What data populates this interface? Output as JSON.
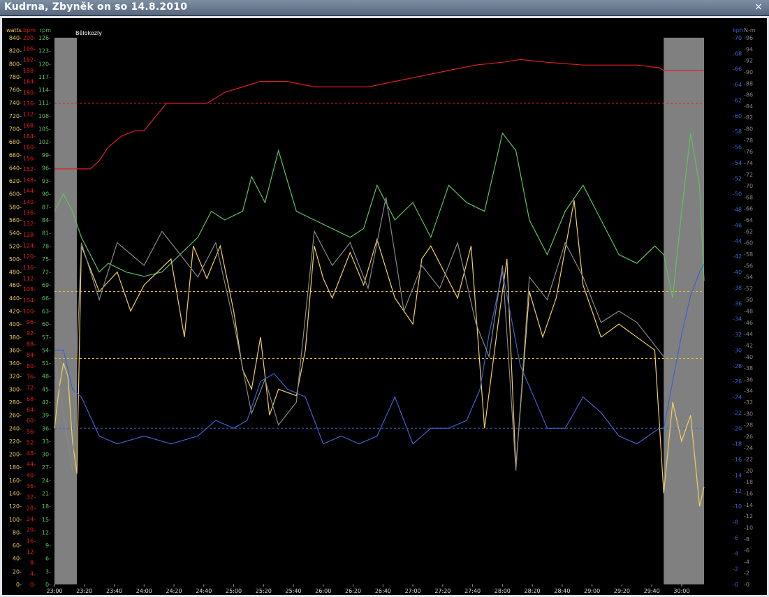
{
  "window": {
    "title": "Kudrna, Zbyněk on so 14.8.2010",
    "close_glyph": "×"
  },
  "chart_data": {
    "type": "line",
    "title": "",
    "annotation": "Bělokozly",
    "xlabel": "",
    "x_tick_labels": [
      "23:00",
      "23:20",
      "23:40",
      "24:00",
      "24:20",
      "24:40",
      "25:00",
      "25:20",
      "25:40",
      "26:00",
      "26:20",
      "26:40",
      "27:00",
      "27:20",
      "27:40",
      "28:00",
      "28:20",
      "28:40",
      "29:00",
      "29:20",
      "29:40",
      "30:00"
    ],
    "x_range_min": [
      23.0,
      30.25
    ],
    "grid": false,
    "shaded_regions_min": [
      [
        23.0,
        23.25
      ],
      [
        29.8,
        30.25
      ]
    ],
    "colors": {
      "watts": "#f0d060",
      "bpm": "#e02020",
      "rpm": "#60c060",
      "kph": "#4060d0",
      "nm": "#888888",
      "shade": "#808080"
    },
    "axes": {
      "watts": {
        "label": "watts",
        "side": "left",
        "range": [
          0,
          840
        ],
        "step": 20
      },
      "bpm": {
        "label": "bpm",
        "side": "left",
        "range": [
          0,
          200
        ],
        "step": 4
      },
      "rpm": {
        "label": "rpm",
        "side": "left",
        "range": [
          0,
          126
        ],
        "step": 3
      },
      "kph": {
        "label": "kph",
        "side": "right",
        "range": [
          0,
          70
        ],
        "step": 2
      },
      "nm": {
        "label": "N-m",
        "side": "right",
        "range": [
          0,
          96
        ],
        "step": 2
      }
    },
    "reference_lines": [
      {
        "series": "bpm",
        "value": 176,
        "color": "#e02020"
      },
      {
        "series": "watts",
        "value": 450,
        "color": "#e8c030"
      },
      {
        "series": "watts",
        "value": 347,
        "color": "#e8c030"
      },
      {
        "series": "kph",
        "value": 20,
        "color": "#4060d0"
      }
    ],
    "series": [
      {
        "name": "bpm",
        "unit_axis": "bpm",
        "x": [
          23.0,
          23.4,
          23.5,
          23.6,
          23.75,
          23.9,
          24.0,
          24.25,
          24.5,
          24.7,
          24.9,
          25.1,
          25.3,
          25.6,
          25.9,
          26.2,
          26.5,
          26.8,
          27.1,
          27.4,
          27.7,
          28.0,
          28.2,
          28.5,
          28.9,
          29.2,
          29.5,
          29.75,
          29.8,
          30.25
        ],
        "values": [
          152,
          152,
          155,
          160,
          164,
          166,
          166,
          176,
          176,
          176,
          180,
          182,
          184,
          184,
          182,
          182,
          182,
          184,
          186,
          188,
          190,
          191,
          192,
          191,
          190,
          190,
          190,
          189,
          188,
          188
        ]
      },
      {
        "name": "rpm",
        "unit_axis": "rpm",
        "x": [
          23.0,
          23.1,
          23.2,
          23.3,
          23.5,
          23.6,
          23.8,
          24.0,
          24.2,
          24.4,
          24.6,
          24.75,
          24.9,
          25.1,
          25.2,
          25.35,
          25.5,
          25.7,
          25.9,
          26.1,
          26.3,
          26.45,
          26.6,
          26.8,
          27.0,
          27.2,
          27.4,
          27.6,
          27.8,
          27.9,
          28.0,
          28.15,
          28.3,
          28.5,
          28.7,
          28.9,
          29.1,
          29.3,
          29.5,
          29.7,
          29.8,
          29.9,
          30.0,
          30.1,
          30.2,
          30.25
        ],
        "values": [
          86,
          90,
          86,
          80,
          72,
          74,
          72,
          71,
          72,
          76,
          80,
          86,
          84,
          86,
          94,
          88,
          100,
          86,
          84,
          82,
          80,
          82,
          92,
          84,
          88,
          80,
          92,
          88,
          86,
          95,
          104,
          100,
          84,
          76,
          86,
          92,
          84,
          76,
          74,
          78,
          76,
          66,
          86,
          104,
          92,
          70
        ]
      },
      {
        "name": "watts",
        "unit_axis": "watts",
        "x": [
          23.0,
          23.05,
          23.1,
          23.15,
          23.2,
          23.25,
          23.3,
          23.5,
          23.7,
          23.85,
          24.0,
          24.15,
          24.3,
          24.45,
          24.55,
          24.7,
          24.85,
          25.0,
          25.1,
          25.2,
          25.3,
          25.4,
          25.5,
          25.7,
          25.8,
          25.9,
          26.0,
          26.1,
          26.3,
          26.45,
          26.6,
          26.8,
          27.0,
          27.1,
          27.2,
          27.35,
          27.5,
          27.65,
          27.8,
          27.95,
          28.05,
          28.15,
          28.3,
          28.45,
          28.6,
          28.8,
          28.9,
          29.0,
          29.1,
          29.3,
          29.5,
          29.7,
          29.8,
          29.9,
          30.0,
          30.1,
          30.2,
          30.25
        ],
        "values": [
          240,
          300,
          340,
          320,
          220,
          170,
          520,
          450,
          480,
          420,
          460,
          480,
          500,
          380,
          520,
          470,
          520,
          420,
          330,
          300,
          380,
          260,
          300,
          290,
          360,
          520,
          470,
          440,
          510,
          460,
          530,
          440,
          400,
          500,
          520,
          480,
          440,
          520,
          240,
          400,
          500,
          180,
          450,
          380,
          440,
          590,
          460,
          420,
          380,
          400,
          380,
          360,
          140,
          280,
          220,
          260,
          120,
          150
        ]
      },
      {
        "name": "kph",
        "unit_axis": "kph",
        "x": [
          23.0,
          23.1,
          23.2,
          23.3,
          23.5,
          23.7,
          24.0,
          24.3,
          24.6,
          24.8,
          25.0,
          25.15,
          25.3,
          25.45,
          25.6,
          25.8,
          26.0,
          26.2,
          26.4,
          26.6,
          26.8,
          27.0,
          27.2,
          27.4,
          27.6,
          27.75,
          27.85,
          28.0,
          28.2,
          28.35,
          28.5,
          28.7,
          28.9,
          29.1,
          29.3,
          29.5,
          29.75,
          29.8,
          29.9,
          30.0,
          30.1,
          30.2,
          30.25
        ],
        "values": [
          30,
          30,
          25,
          24,
          19,
          18,
          19,
          18,
          19,
          21,
          20,
          21,
          26,
          27,
          25,
          24,
          18,
          19,
          18,
          19,
          24,
          18,
          20,
          20,
          21,
          25,
          32,
          40,
          28,
          24,
          20,
          20,
          24,
          22,
          19,
          18,
          20,
          20,
          26,
          32,
          37,
          40,
          41
        ]
      },
      {
        "name": "N-m",
        "unit_axis": "nm",
        "x": [
          23.0,
          23.2,
          23.3,
          23.5,
          23.7,
          24.0,
          24.2,
          24.4,
          24.6,
          24.8,
          25.0,
          25.2,
          25.35,
          25.5,
          25.7,
          25.9,
          26.1,
          26.3,
          26.5,
          26.7,
          26.9,
          27.1,
          27.3,
          27.5,
          27.7,
          27.85,
          28.0,
          28.15,
          28.3,
          28.5,
          28.7,
          28.9,
          29.1,
          29.3,
          29.5,
          29.8
        ],
        "values": [
          40,
          20,
          60,
          50,
          60,
          56,
          62,
          58,
          54,
          60,
          46,
          30,
          36,
          28,
          32,
          62,
          56,
          60,
          52,
          68,
          48,
          56,
          52,
          60,
          46,
          40,
          56,
          20,
          54,
          50,
          60,
          54,
          46,
          48,
          46,
          40
        ]
      }
    ]
  }
}
